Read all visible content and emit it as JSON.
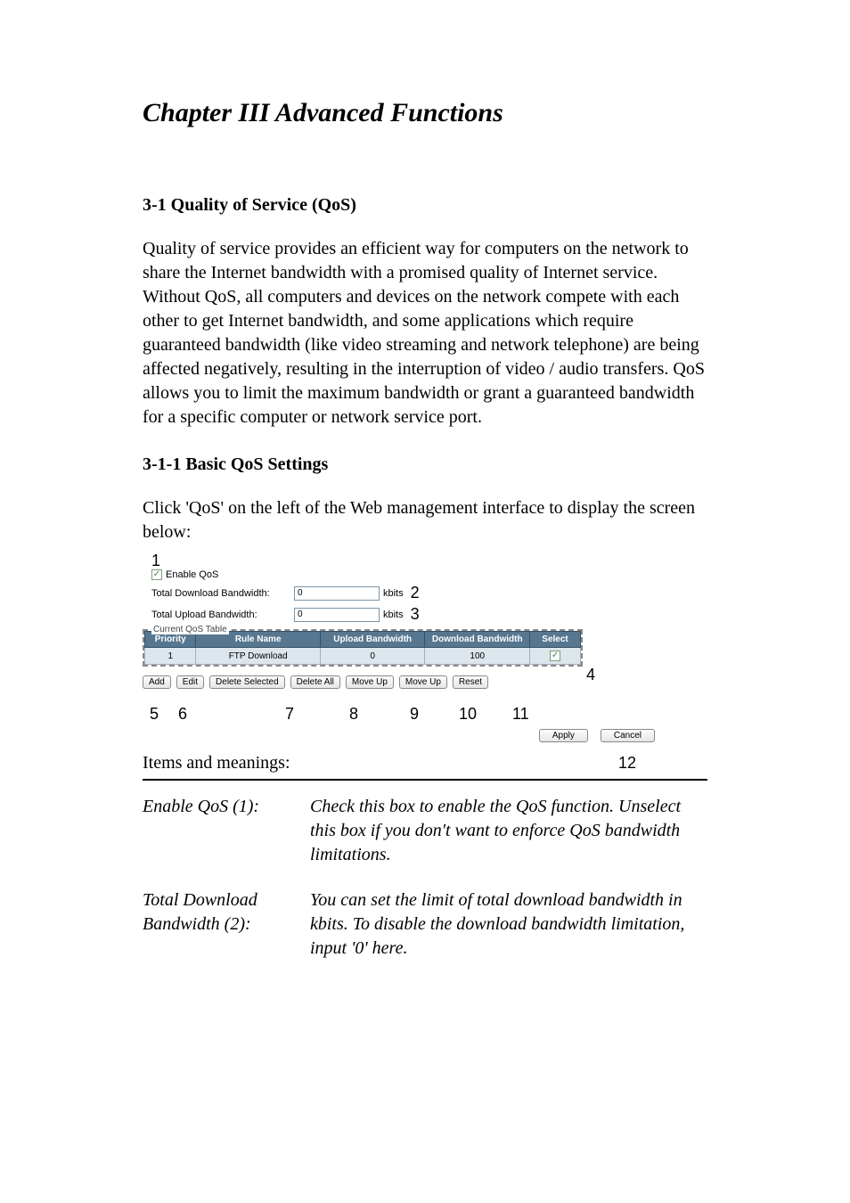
{
  "chapter_title": "Chapter III    Advanced Functions",
  "section_3_1": "3-1 Quality of Service (QoS)",
  "para_intro": "Quality of service provides an efficient way for computers on the network to share the Internet bandwidth with a promised quality of Internet service. Without QoS, all computers and devices on the network compete with each other to get Internet bandwidth, and some applications which require guaranteed bandwidth (like video streaming and network telephone) are being affected negatively, resulting in the interruption of video / audio transfers. QoS allows you to limit the maximum bandwidth or grant a guaranteed bandwidth for a specific computer or network service port.",
  "section_3_1_1": "3-1-1 Basic QoS Settings",
  "para_click": "Click 'QoS' on the left of the Web management interface to display the screen below:",
  "screenshot": {
    "callouts": {
      "c1": "1",
      "c2": "2",
      "c3": "3",
      "c4": "4",
      "c5": "5",
      "c6": "6",
      "c7": "7",
      "c8": "8",
      "c9": "9",
      "c10": "10",
      "c11": "11",
      "c12": "12"
    },
    "enable_label": "Enable QoS",
    "dl_label": "Total Download Bandwidth:",
    "ul_label": "Total Upload Bandwidth:",
    "dl_value": "0",
    "ul_value": "0",
    "unit": "kbits",
    "table_legend": "Current QoS Table",
    "headers": {
      "priority": "Priority",
      "rule": "Rule Name",
      "up": "Upload Bandwidth",
      "down": "Download Bandwidth",
      "select": "Select"
    },
    "row": {
      "priority": "1",
      "rule": "FTP Download",
      "up": "0",
      "down": "100"
    },
    "buttons": {
      "add": "Add",
      "edit": "Edit",
      "delsel": "Delete Selected",
      "delall": "Delete All",
      "moveup1": "Move Up",
      "moveup2": "Move Up",
      "reset": "Reset",
      "apply": "Apply",
      "cancel": "Cancel"
    }
  },
  "items_label": "Items and meanings:",
  "defs": [
    {
      "term": "Enable QoS (1):",
      "desc": "Check this box to enable the QoS function. Unselect this box if you don't want to enforce QoS bandwidth limitations."
    },
    {
      "term": "Total Download Bandwidth (2):",
      "desc": "You can set the limit of total download bandwidth in kbits. To disable the download bandwidth limitation, input '0' here."
    }
  ]
}
